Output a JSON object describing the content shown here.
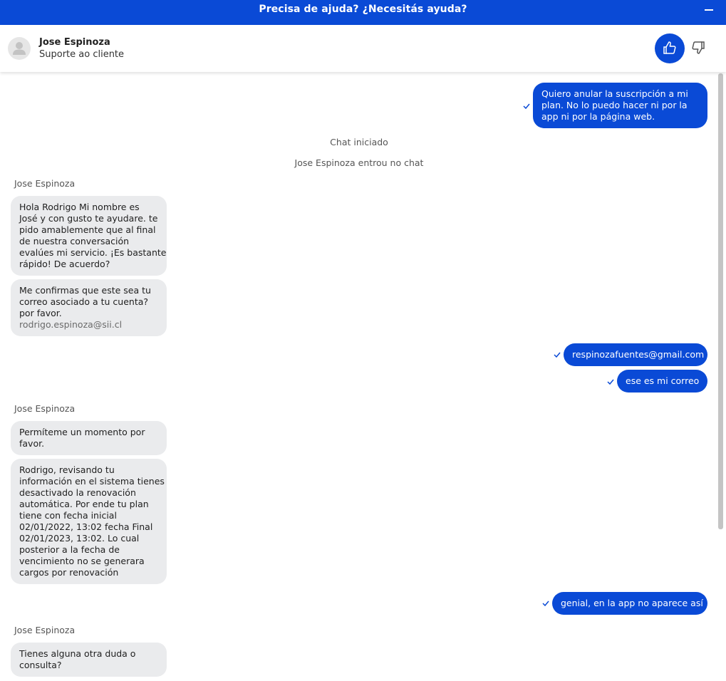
{
  "header": {
    "title": "Precisa de ajuda? ¿Necesitás ayuda?"
  },
  "agent": {
    "name": "Jose Espinoza",
    "role": "Suporte ao cliente"
  },
  "colors": {
    "primary": "#0a4ad6",
    "incoming_bubble": "#eaebed"
  },
  "icons": {
    "minimize": "minimize-icon",
    "avatar": "user-icon",
    "like": "thumbs-up-icon",
    "dislike": "thumbs-down-icon",
    "delivered": "check-icon"
  },
  "messages": {
    "m1": [
      "Quiero anular la suscripción a mi",
      "plan. No lo puedo hacer ni por la",
      "app ni por la página web."
    ],
    "sys1": "Chat iniciado",
    "sys2": "Jose Espinoza entrou no chat",
    "sender1": "Jose Espinoza",
    "a1": [
      "Hola Rodrigo Mi nombre es",
      "José y con gusto te ayudare. te",
      "pido amablemente que al final",
      "de nuestra conversación",
      "evalúes mi servicio. ¡Es bastante",
      "rápido! De acuerdo?"
    ],
    "a2": [
      "Me confirmas que este sea tu",
      "correo asociado a tu cuenta?",
      "por favor."
    ],
    "a2_email": "rodrigo.espinoza@sii.cl",
    "m2": "respinozafuentes@gmail.com",
    "m3": "ese es mi correo",
    "sender2": "Jose Espinoza",
    "a3": [
      "Permíteme un momento por",
      "favor."
    ],
    "a4": [
      "Rodrigo, revisando tu",
      "información en el sistema tienes",
      "desactivado la renovación",
      "automática. Por ende tu plan",
      "tiene con fecha inicial",
      "02/01/2022, 13:02 fecha Final",
      "02/01/2023, 13:02. Lo cual",
      "posterior a la fecha de",
      "vencimiento no se generara",
      "cargos por renovación"
    ],
    "m4": "genial, en la app no aparece así",
    "sender3": "Jose Espinoza",
    "a5": [
      "Tienes alguna otra duda o",
      "consulta?"
    ]
  }
}
